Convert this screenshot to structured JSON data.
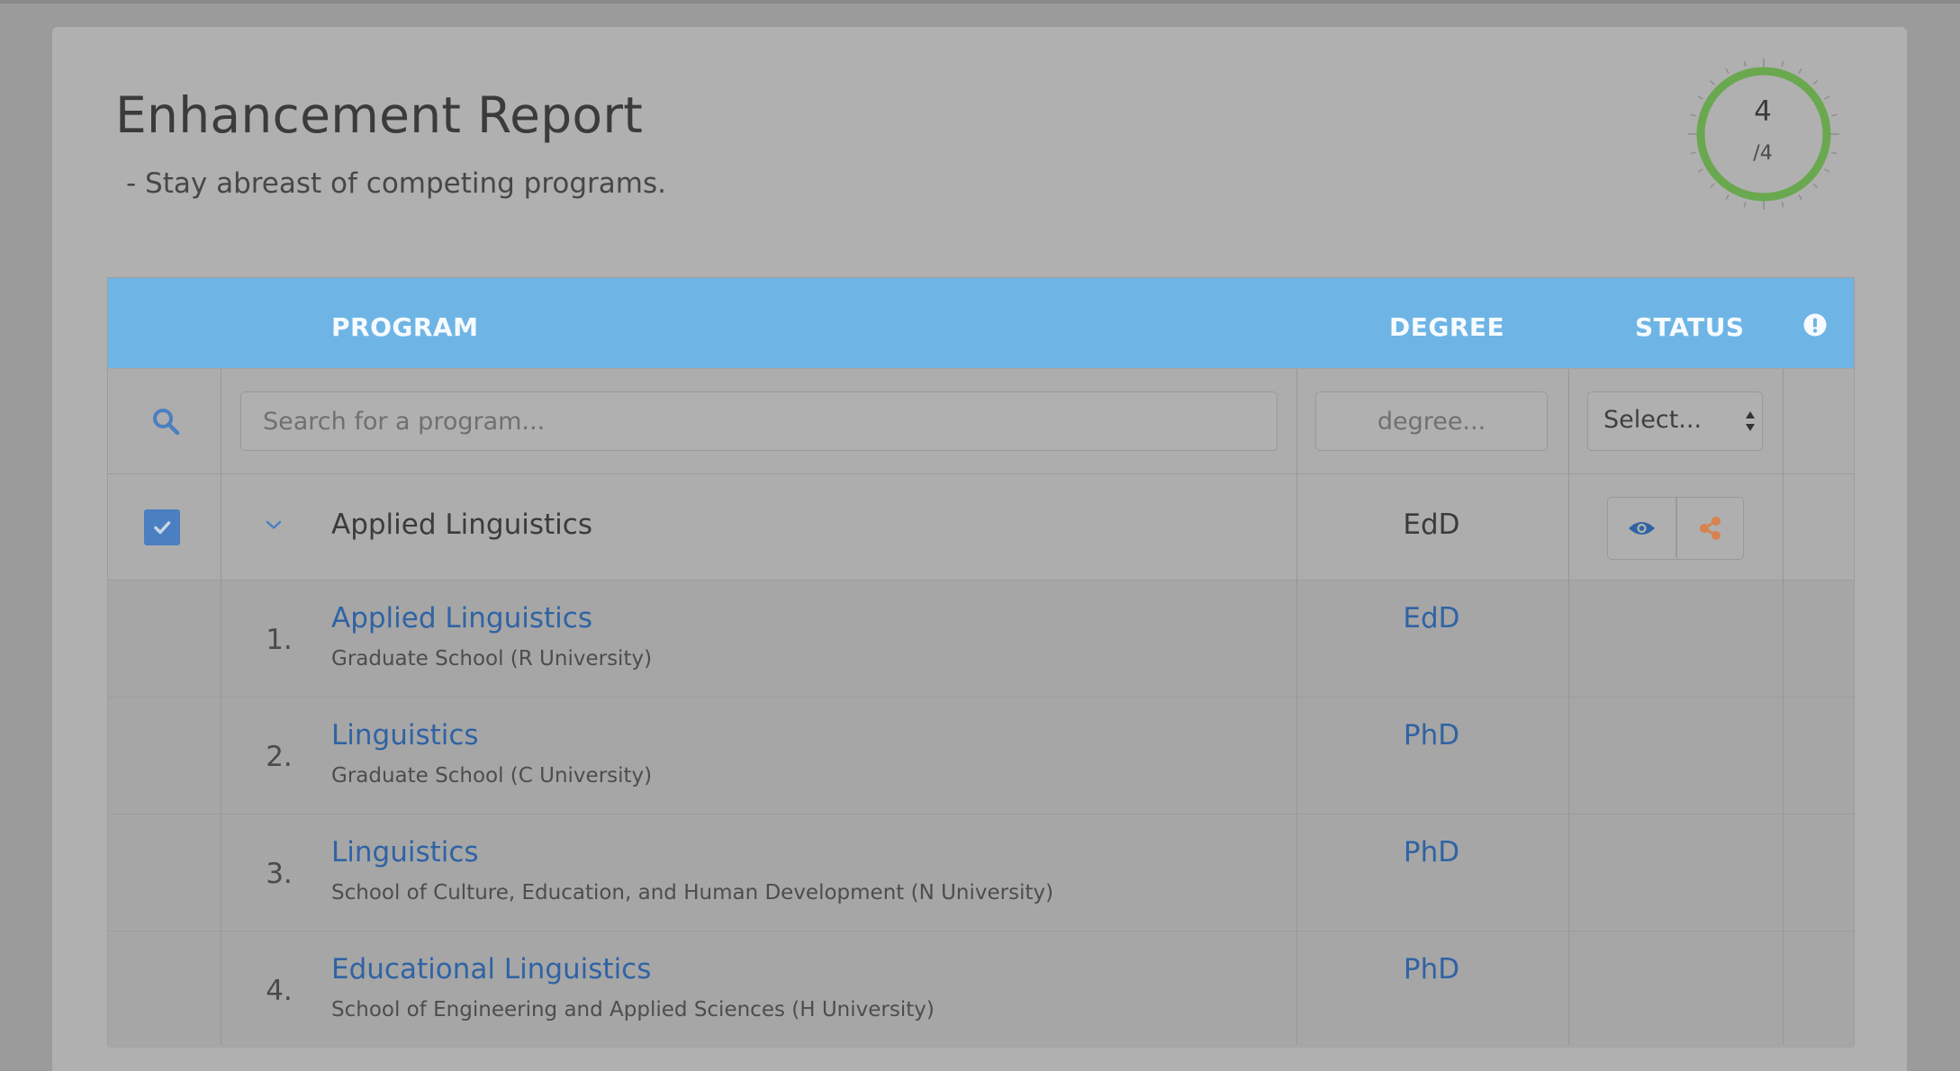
{
  "report": {
    "title": "Enhancement Report",
    "subtitle": "- Stay abreast of competing programs."
  },
  "gauge": {
    "value": "4",
    "total": "/4",
    "fraction": 1.0,
    "color": "#6aa84f"
  },
  "table": {
    "headers": {
      "program": "PROGRAM",
      "degree": "DEGREE",
      "status": "STATUS"
    },
    "header_color": "#6eb5e6",
    "filters": {
      "program_placeholder": "Search for a program...",
      "degree_placeholder": "degree...",
      "status_selected": "Select..."
    },
    "group": {
      "name": "Applied Linguistics",
      "degree": "EdD",
      "checked": true
    },
    "rows": [
      {
        "num": "1.",
        "program": "Applied Linguistics",
        "school": "Graduate School (R University)",
        "degree": "EdD"
      },
      {
        "num": "2.",
        "program": "Linguistics",
        "school": "Graduate School (C University)",
        "degree": "PhD"
      },
      {
        "num": "3.",
        "program": "Linguistics",
        "school": "School of Culture, Education, and Human Development (N University)",
        "degree": "PhD"
      },
      {
        "num": "4.",
        "program": "Educational Linguistics",
        "school": "School of Engineering and Applied Sciences (H University)",
        "degree": "PhD"
      }
    ]
  },
  "icons": {
    "search": "search-icon",
    "info": "info-icon",
    "chevron": "chevron-down-icon",
    "eye": "eye-icon",
    "share": "share-icon",
    "check": "check-icon"
  },
  "colors": {
    "link": "#2f63a4",
    "share": "#d7824f",
    "checkbox": "#4a7fc1"
  }
}
